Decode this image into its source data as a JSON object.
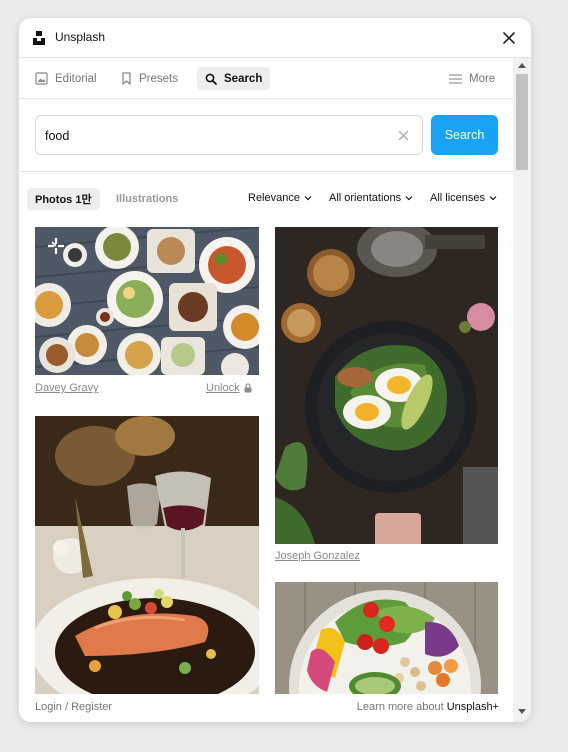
{
  "window": {
    "title": "Unsplash"
  },
  "tabs": [
    {
      "label": "Editorial",
      "icon": "image-icon",
      "active": false
    },
    {
      "label": "Presets",
      "icon": "bookmark-icon",
      "active": false
    },
    {
      "label": "Search",
      "icon": "search-icon",
      "active": true
    }
  ],
  "more": {
    "label": "More",
    "icon": "hamburger-icon"
  },
  "search": {
    "value": "food",
    "button_label": "Search"
  },
  "filters": {
    "photos_label": "Photos 1만",
    "illustrations_label": "Illustrations",
    "sort_label": "Relevance",
    "orientation_label": "All orientations",
    "license_label": "All licenses"
  },
  "photos": [
    {
      "credit": "Davey Gravy",
      "action": "Unlock",
      "premium": true,
      "subject": "food table spread"
    },
    {
      "credit": "Joseph Gonzalez",
      "subject": "egg salad bowl"
    },
    {
      "credit": "",
      "subject": "salmon plate with wine"
    },
    {
      "credit": "",
      "subject": "vegetable salad bowl"
    }
  ],
  "footer": {
    "login_label": "Login / Register",
    "learn_prefix": "Learn more about",
    "learn_link": "Unsplash+"
  },
  "colors": {
    "accent": "#18a3f5",
    "active_tab_bg": "#eeeeee"
  }
}
